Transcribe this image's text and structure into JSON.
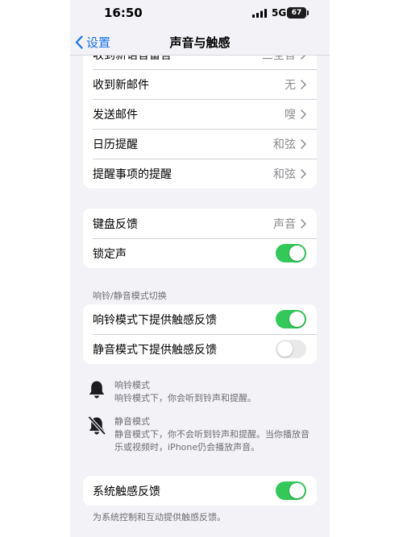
{
  "status_bar": {
    "time": "16:50",
    "network": "5G",
    "battery": "67",
    "signal_icon": "cellular-signal-icon"
  },
  "nav": {
    "back_label": "设置",
    "title": "声音与触感",
    "back_icon": "chevron-left-icon"
  },
  "alerts_group": {
    "rows": [
      {
        "label": "收到新语音留言",
        "value": "三全音"
      },
      {
        "label": "收到新邮件",
        "value": "无"
      },
      {
        "label": "发送邮件",
        "value": "嗖"
      },
      {
        "label": "日历提醒",
        "value": "和弦"
      },
      {
        "label": "提醒事项的提醒",
        "value": "和弦"
      }
    ]
  },
  "system_group": {
    "keyboard_label": "键盘反馈",
    "keyboard_value": "声音",
    "lock_label": "锁定声",
    "lock_on": true
  },
  "ring_silent": {
    "header": "响铃/静音模式切换",
    "ring_haptics_label": "响铃模式下提供触感反馈",
    "ring_haptics_on": true,
    "silent_haptics_label": "静音模式下提供触感反馈",
    "silent_haptics_on": false,
    "ring_mode": {
      "icon": "bell-icon",
      "title": "响铃模式",
      "text": "响铃模式下，你会听到铃声和提醒。"
    },
    "silent_mode": {
      "icon": "bell-slash-icon",
      "title": "静音模式",
      "text": "静音模式下，你不会听到铃声和提醒。当你播放音乐或视频时，iPhone仍会播放声音。"
    }
  },
  "system_haptics": {
    "label": "系统触感反馈",
    "on": true,
    "footer": "为系统控制和互动提供触感反馈。"
  },
  "colors": {
    "accent": "#1a73e8",
    "toggle_on": "#34c759",
    "background": "#f2f2f7"
  }
}
